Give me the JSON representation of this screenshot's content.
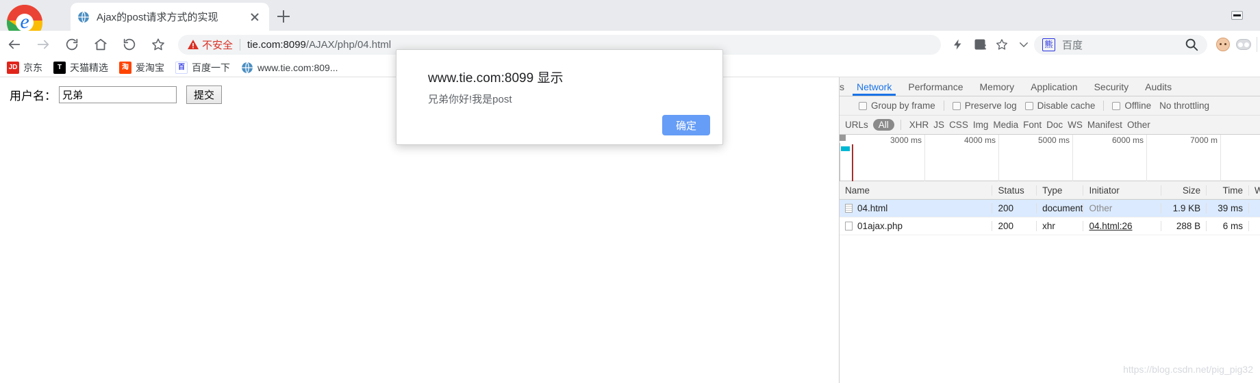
{
  "window": {
    "minimize_tooltip": "Minimize"
  },
  "tab": {
    "title": "Ajax的post请求方式的实现",
    "favicon": "globe-icon",
    "close": "×",
    "new_tab": "+"
  },
  "toolbar": {
    "back": "back-arrow-icon",
    "forward": "forward-arrow-icon",
    "reload": "reload-icon",
    "home": "home-icon",
    "history": "history-back-icon",
    "bookmark_star": "star-icon",
    "security_label": "不安全",
    "url_host": "tie.com:8099",
    "url_path": "/AJAX/php/04.html",
    "url_full": "tie.com:8099/AJAX/php/04.html",
    "icons": {
      "flash": "lightning-icon",
      "translate": "translate-icon",
      "star": "star-icon",
      "chevron": "chevron-down-icon"
    }
  },
  "search": {
    "engine_icon": "baidu-paw-icon",
    "placeholder": "百度",
    "magnifier": "search-icon"
  },
  "profile": {
    "avatar": "monkey-avatar-icon",
    "extensions": "extension-icon"
  },
  "bookmarks": [
    {
      "icon": "jd-icon",
      "icon_text": "JD",
      "label": "京东"
    },
    {
      "icon": "tmall-icon",
      "icon_text": "T",
      "label": "天猫精选"
    },
    {
      "icon": "taobao-icon",
      "icon_text": "淘",
      "label": "爱淘宝"
    },
    {
      "icon": "baidu-icon",
      "icon_text": "百",
      "label": "百度一下"
    },
    {
      "icon": "globe-icon",
      "icon_text": "",
      "label": "www.tie.com:809..."
    }
  ],
  "page": {
    "username_label": "用户名：",
    "username_value": "兄弟",
    "username_placeholder": "",
    "submit_label": "提交"
  },
  "dialog": {
    "title": "www.tie.com:8099 显示",
    "message": "兄弟你好!我是post",
    "ok_label": "确定"
  },
  "devtools": {
    "tabs": [
      {
        "label": "s",
        "active": false,
        "clipped": true
      },
      {
        "label": "Network",
        "active": true,
        "clipped": false
      },
      {
        "label": "Performance",
        "active": false,
        "clipped": false
      },
      {
        "label": "Memory",
        "active": false,
        "clipped": false
      },
      {
        "label": "Application",
        "active": false,
        "clipped": false
      },
      {
        "label": "Security",
        "active": false,
        "clipped": false
      },
      {
        "label": "Audits",
        "active": false,
        "clipped": false
      }
    ],
    "options": {
      "group_by_frame": "Group by frame",
      "preserve_log": "Preserve log",
      "disable_cache": "Disable cache",
      "offline": "Offline",
      "throttling": "No throttling"
    },
    "filters": {
      "urls_label": "URLs",
      "all": "All",
      "types": [
        "XHR",
        "JS",
        "CSS",
        "Img",
        "Media",
        "Font",
        "Doc",
        "WS",
        "Manifest",
        "Other"
      ]
    },
    "timeline_ticks": [
      "3000 ms",
      "4000 ms",
      "5000 ms",
      "6000 ms",
      "7000 m"
    ],
    "columns": [
      "Name",
      "Status",
      "Type",
      "Initiator",
      "Size",
      "Time",
      "Waterfall"
    ],
    "requests": [
      {
        "name": "04.html",
        "status": "200",
        "type": "document",
        "initiator": "Other",
        "size": "1.9 KB",
        "time": "39 ms",
        "selected": true,
        "initiator_is_link": false
      },
      {
        "name": "01ajax.php",
        "status": "200",
        "type": "xhr",
        "initiator": "04.html:26",
        "size": "288 B",
        "time": "6 ms",
        "selected": false,
        "initiator_is_link": true
      }
    ]
  },
  "watermark": "https://blog.csdn.net/pig_pig32",
  "colors": {
    "accent": "#1a73e8",
    "insecure": "#d93025",
    "dialog_button": "#669df6",
    "selected_row": "#dbeafe"
  }
}
